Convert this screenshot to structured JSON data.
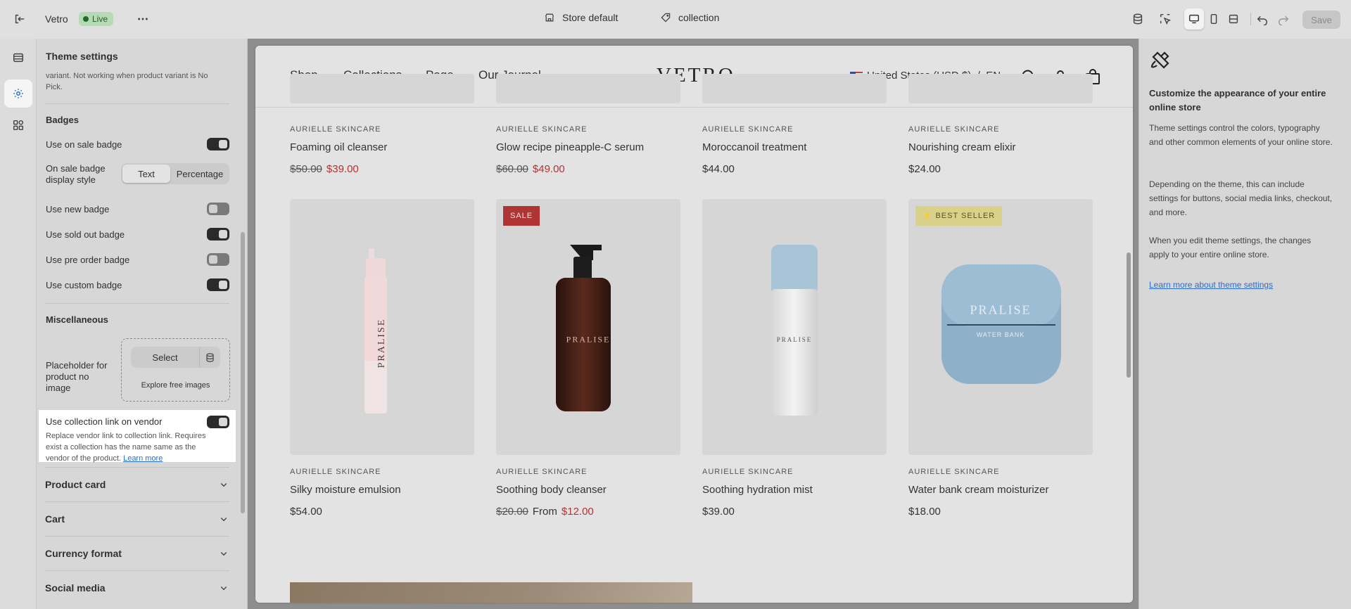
{
  "topbar": {
    "store_name": "Vetro",
    "live_badge": "Live",
    "template_label": "Store default",
    "page_label": "collection",
    "save_label": "Save"
  },
  "panel": {
    "title": "Theme settings",
    "note": "variant. Not working when product variant is No Pick.",
    "badges_heading": "Badges",
    "on_sale_badge": {
      "label": "Use on sale badge",
      "on": true
    },
    "display_style": {
      "label": "On sale badge display style",
      "options": [
        "Text",
        "Percentage"
      ],
      "selected": "Text"
    },
    "new_badge": {
      "label": "Use new badge",
      "on": false
    },
    "sold_out_badge": {
      "label": "Use sold out badge",
      "on": true
    },
    "pre_order_badge": {
      "label": "Use pre order badge",
      "on": false
    },
    "custom_badge": {
      "label": "Use custom badge",
      "on": true
    },
    "misc_heading": "Miscellaneous",
    "placeholder": {
      "label": "Placeholder for product no image",
      "select_label": "Select",
      "explore_label": "Explore free images"
    },
    "collection_link": {
      "label": "Use collection link on vendor",
      "on": true,
      "help": "Replace vendor link to collection link. Requires exist a collection has the name same as the vendor of the product.",
      "learn_more": "Learn more"
    },
    "accordions": [
      "Product card",
      "Cart",
      "Currency format",
      "Social media"
    ]
  },
  "store": {
    "nav": [
      "Shop",
      "Collections",
      "Page",
      "Our Journal"
    ],
    "logo": "VETRO",
    "locale": "United States (USD $)  /  EN",
    "top_row": [
      {
        "brand": "AURIELLE SKINCARE",
        "name": "Foaming oil cleanser",
        "compare": "$50.00",
        "price": "$39.00",
        "prefix": ""
      },
      {
        "brand": "AURIELLE SKINCARE",
        "name": "Glow recipe pineapple-C serum",
        "compare": "$60.00",
        "price": "$49.00",
        "prefix": ""
      },
      {
        "brand": "AURIELLE SKINCARE",
        "name": "Moroccanoil treatment",
        "compare": "",
        "price": "$44.00",
        "prefix": ""
      },
      {
        "brand": "AURIELLE SKINCARE",
        "name": "Nourishing cream elixir",
        "compare": "",
        "price": "$24.00",
        "prefix": ""
      }
    ],
    "bottom_row": [
      {
        "brand": "AURIELLE SKINCARE",
        "name": "Silky moisture emulsion",
        "compare": "",
        "price": "$54.00",
        "prefix": "",
        "badge": "",
        "product_text": "PRALISE"
      },
      {
        "brand": "AURIELLE SKINCARE",
        "name": "Soothing body cleanser",
        "compare": "$20.00",
        "price": "$12.00",
        "prefix": "From",
        "badge": "SALE",
        "product_text": "PRALISE"
      },
      {
        "brand": "AURIELLE SKINCARE",
        "name": "Soothing hydration mist",
        "compare": "",
        "price": "$39.00",
        "prefix": "",
        "badge": "",
        "product_text": "PRALISE"
      },
      {
        "brand": "AURIELLE SKINCARE",
        "name": "Water bank cream moisturizer",
        "compare": "",
        "price": "$18.00",
        "prefix": "",
        "badge": "BEST SELLER",
        "product_text": "PRALISE"
      }
    ],
    "jar_subtext": "WATER BANK"
  },
  "info": {
    "title": "Customize the appearance of your entire online store",
    "p1": "Theme settings control the colors, typography and other common elements of your online store.",
    "p2": "Depending on the theme, this can include settings for buttons, social media links, checkout, and more.",
    "p3": "When you edit theme settings, the changes apply to your entire online store.",
    "link": "Learn more about theme settings"
  },
  "colors": {
    "sale_red": "#b13434",
    "best_seller": "#d9d08a",
    "link_blue": "#2c6ecb"
  }
}
